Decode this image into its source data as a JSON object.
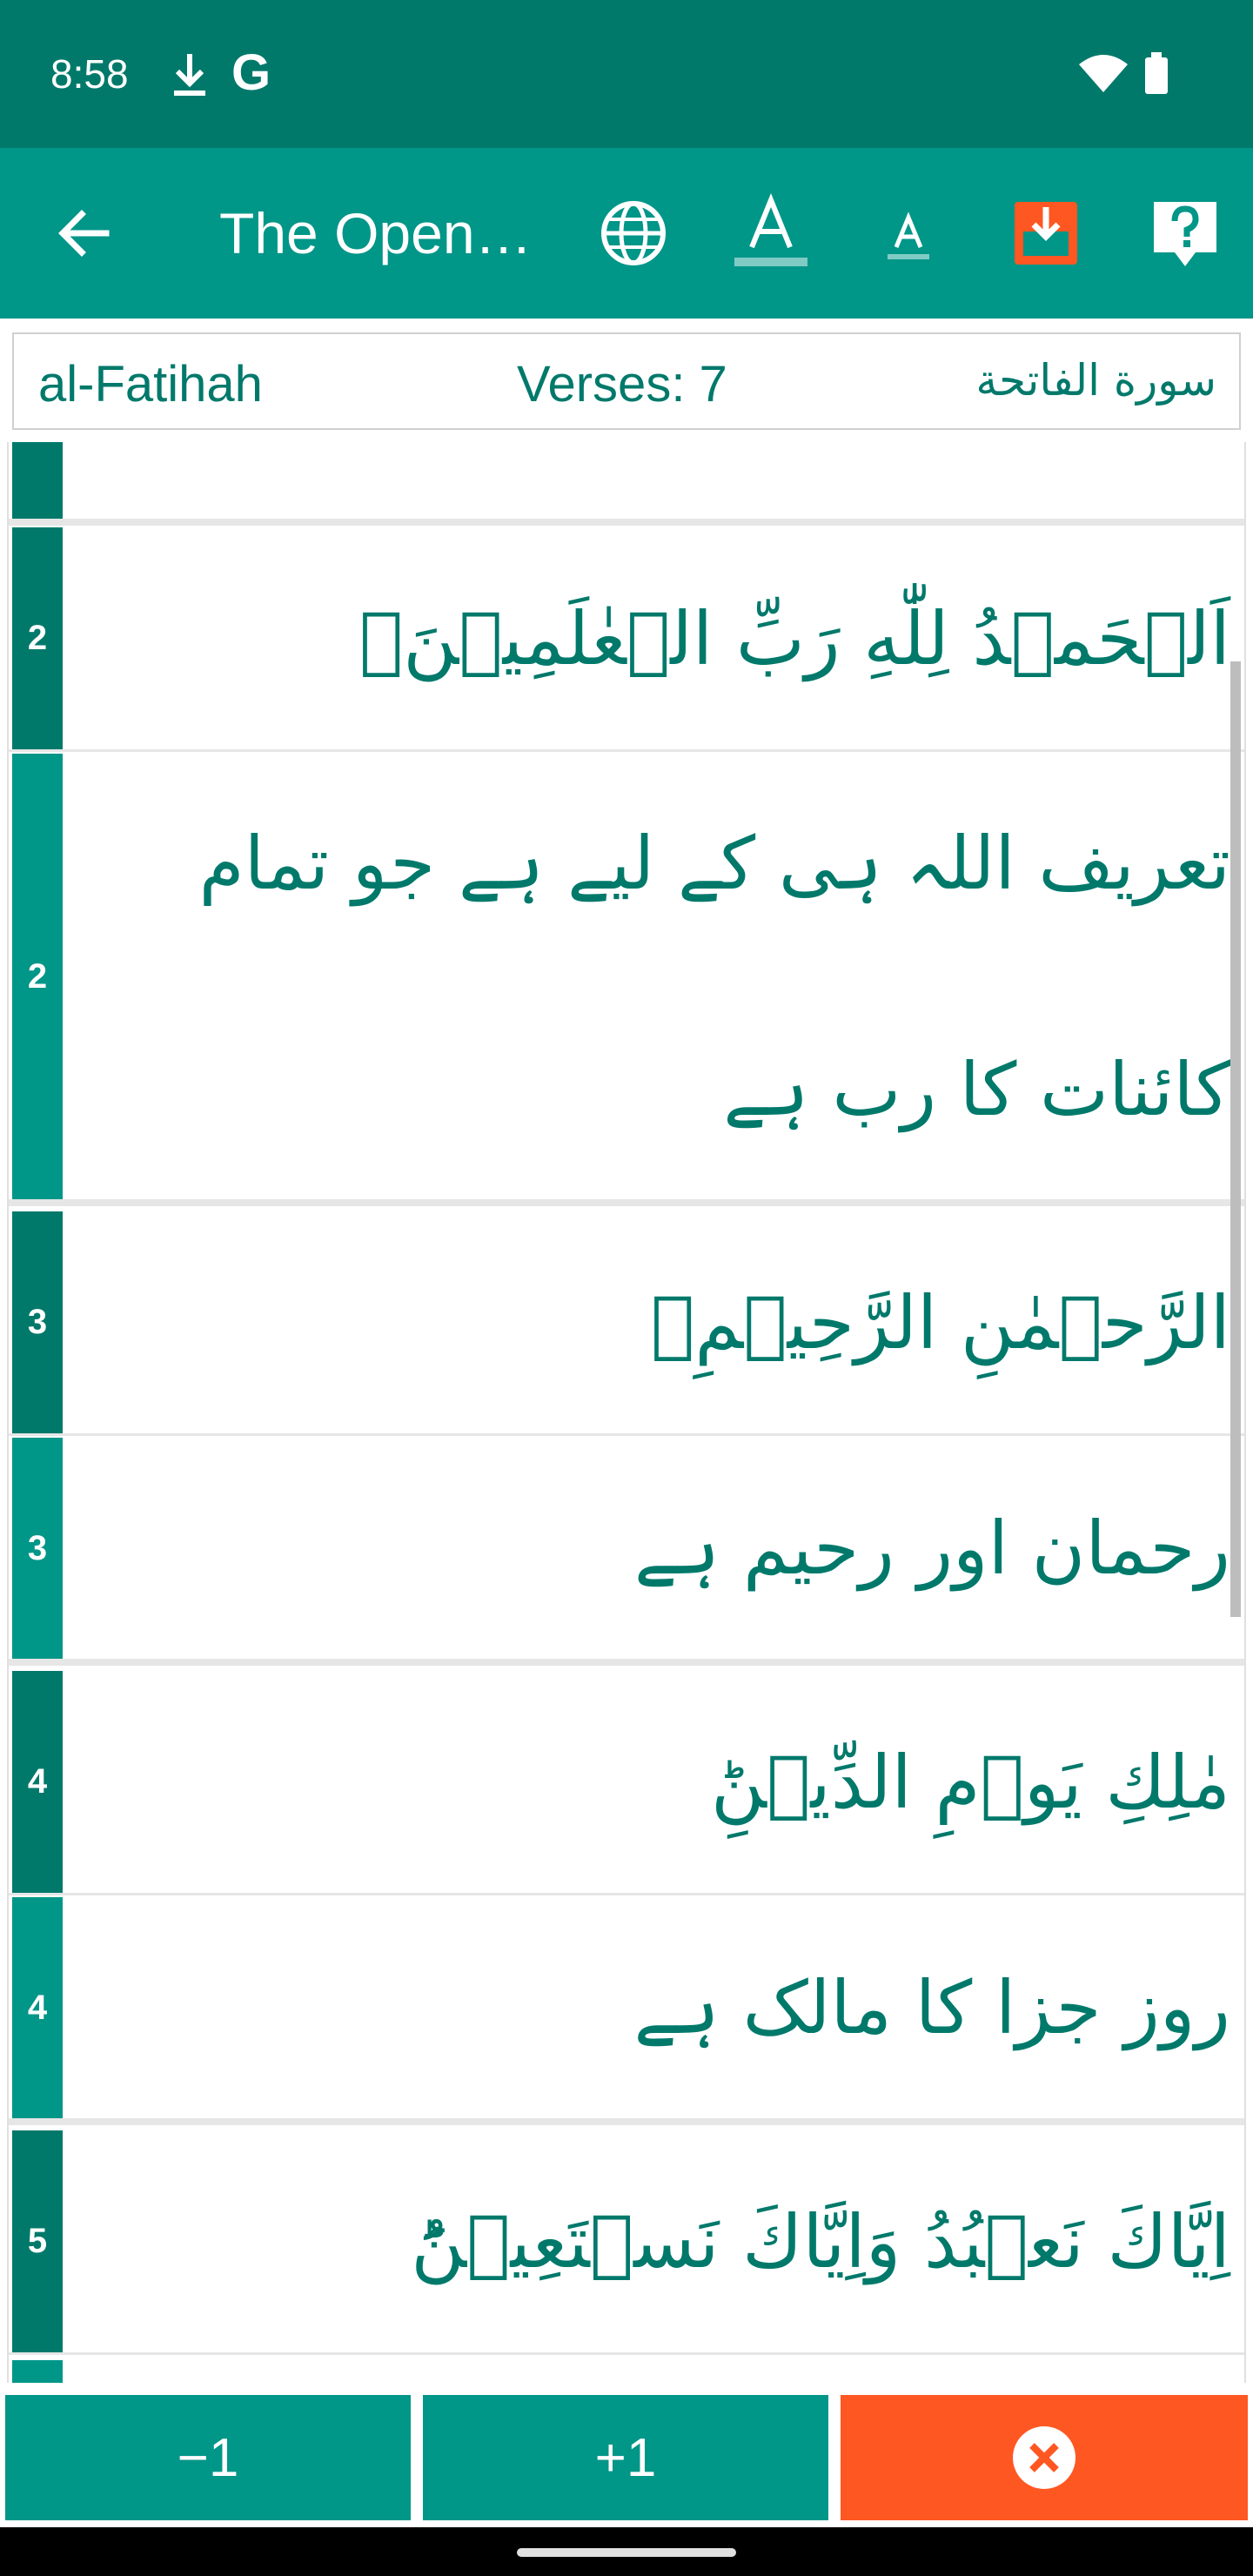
{
  "status_bar": {
    "time": "8:58",
    "g_label": "G"
  },
  "app_bar": {
    "title": "The Opening"
  },
  "info": {
    "name": "al-Fatihah",
    "verses": "Verses: 7",
    "arabic_name": "سورة الفاتحة"
  },
  "verses": [
    {
      "num": "2",
      "kind": "arabic",
      "text": "اَلۡحَمۡدُ لِلّٰهِ رَبِّ الۡعٰلَمِيۡنَۙ"
    },
    {
      "num": "2",
      "kind": "urdu",
      "text": "تعریف اللہ ہی کے لیے ہے جو تمام کائنات کا رب ہے"
    },
    {
      "num": "3",
      "kind": "arabic",
      "text": "الرَّحۡمٰنِ الرَّحِيۡمِۙ"
    },
    {
      "num": "3",
      "kind": "urdu",
      "text": "رحمان اور رحیم ہے"
    },
    {
      "num": "4",
      "kind": "arabic",
      "text": "مٰلِكِ يَوۡمِ الدِّيۡنِؕ"
    },
    {
      "num": "4",
      "kind": "urdu",
      "text": "روز جزا کا مالک ہے"
    },
    {
      "num": "5",
      "kind": "arabic",
      "text": "اِيَّاكَ نَعۡبُدُ وَاِيَّاكَ نَسۡتَعِيۡنُؕ"
    }
  ],
  "buttons": {
    "minus": "−1",
    "plus": "+1"
  },
  "colors": {
    "primary": "#009688",
    "primary_dark": "#00796b",
    "accent": "#ff5722"
  }
}
